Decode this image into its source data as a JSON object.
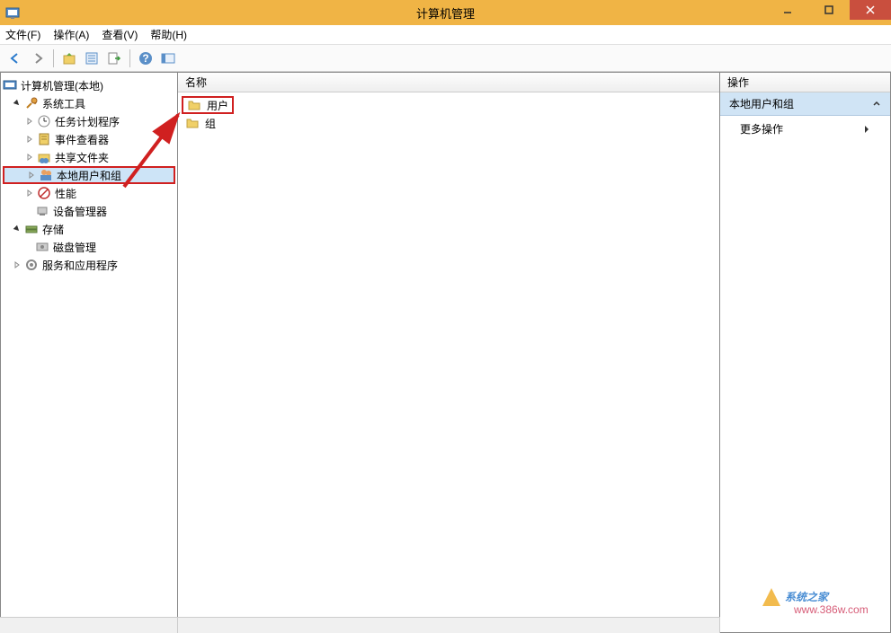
{
  "window": {
    "title": "计算机管理"
  },
  "menu": {
    "file": "文件(F)",
    "action": "操作(A)",
    "view": "查看(V)",
    "help": "帮助(H)"
  },
  "tree": {
    "root": "计算机管理(本地)",
    "system_tools": "系统工具",
    "task_scheduler": "任务计划程序",
    "event_viewer": "事件查看器",
    "shared_folders": "共享文件夹",
    "local_users_groups": "本地用户和组",
    "performance": "性能",
    "device_manager": "设备管理器",
    "storage": "存储",
    "disk_management": "磁盘管理",
    "services_apps": "服务和应用程序"
  },
  "list": {
    "header_name": "名称",
    "item_users": "用户",
    "item_groups": "组"
  },
  "actions": {
    "header": "操作",
    "section": "本地用户和组",
    "more": "更多操作"
  },
  "watermark": {
    "text": "系统之家",
    "url": "www.386w.com"
  }
}
